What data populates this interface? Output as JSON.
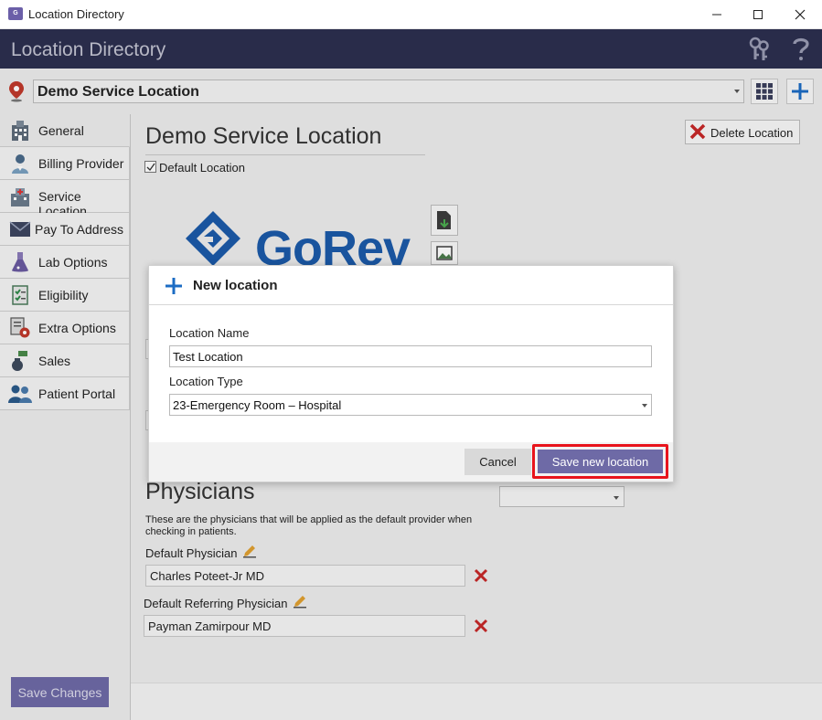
{
  "window": {
    "title": "Location Directory",
    "app_icon_text": "GoRev"
  },
  "header": {
    "app_title": "Location Directory"
  },
  "selector": {
    "current_location": "Demo Service Location"
  },
  "sidebar": {
    "items": [
      {
        "label": "General",
        "icon": "building-icon"
      },
      {
        "label": "Billing Provider",
        "icon": "doctor-icon"
      },
      {
        "label": "Service Location",
        "icon": "hospital-icon"
      },
      {
        "label": "Pay To Address",
        "icon": "envelope-icon"
      },
      {
        "label": "Lab Options",
        "icon": "flask-icon"
      },
      {
        "label": "Eligibility",
        "icon": "checklist-icon"
      },
      {
        "label": "Extra Options",
        "icon": "settings-doc-icon"
      },
      {
        "label": "Sales",
        "icon": "money-icon"
      },
      {
        "label": "Patient Portal",
        "icon": "users-icon"
      }
    ],
    "save_changes": "Save Changes"
  },
  "main": {
    "location_heading": "Demo Service Location",
    "delete_location": "Delete Location",
    "default_location_label": "Default Location",
    "default_location_checked": true,
    "logo_text": "GoRev",
    "physicians_heading": "Physicians",
    "physicians_description": "These are the physicians that will be applied as the default provider when checking in patients.",
    "default_physician_label": "Default Physician",
    "default_physician_value": "Charles Poteet-Jr MD",
    "default_referring_label": "Default Referring Physician",
    "default_referring_value": "Payman Zamirpour MD"
  },
  "dialog": {
    "title": "New location",
    "location_name_label": "Location Name",
    "location_name_value": "Test Location",
    "location_type_label": "Location Type",
    "location_type_value": "23-Emergency Room – Hospital",
    "cancel": "Cancel",
    "save": "Save new location"
  },
  "colors": {
    "header_bg": "#2c2f4f",
    "accent_button": "#6e6aa6",
    "highlight_border": "#e8141c",
    "logo_blue": "#1b5aa8",
    "delete_red": "#c62828"
  }
}
